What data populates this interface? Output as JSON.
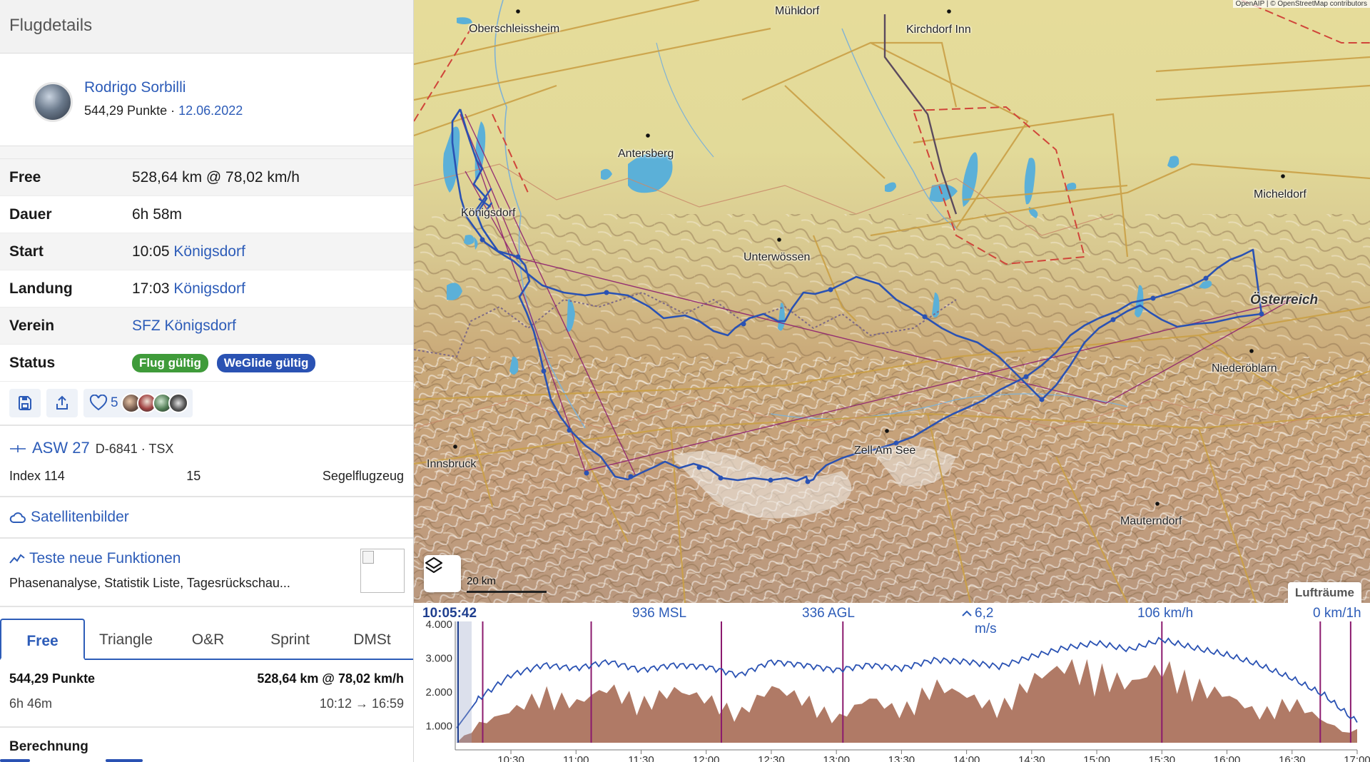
{
  "sidebar": {
    "title": "Flugdetails",
    "pilot": {
      "name": "Rodrigo Sorbilli",
      "points": "544,29 Punkte",
      "separator": "·",
      "date": "12.06.2022"
    },
    "details": [
      {
        "label": "Free",
        "value": "528,64 km @ 78,02 km/h"
      },
      {
        "label": "Dauer",
        "value": "6h 58m"
      },
      {
        "label": "Start",
        "time": "10:05",
        "place": "Königsdorf"
      },
      {
        "label": "Landung",
        "time": "17:03",
        "place": "Königsdorf"
      },
      {
        "label": "Verein",
        "club": "SFZ Königsdorf"
      },
      {
        "label": "Status",
        "badges": [
          "Flug gültig",
          "WeGlide gültig"
        ]
      }
    ],
    "likes": "5",
    "aircraft": {
      "type": "ASW 27",
      "registration": "D-6841 · TSX",
      "index": "Index 114",
      "number": "15",
      "category": "Segelflugzeug"
    },
    "satellite": "Satellitenbilder",
    "new_features": {
      "title": "Teste neue Funktionen",
      "desc": "Phasenanalyse, Statistik Liste, Tagesrückschau..."
    },
    "tabs": [
      "Free",
      "Triangle",
      "O&R",
      "Sprint",
      "DMSt"
    ],
    "score": {
      "points": "544,29 Punkte",
      "distance": "528,64 km @ 78,02 km/h",
      "duration": "6h 46m",
      "span": "10:12 → 16:59"
    },
    "calculation": "Berechnung"
  },
  "map": {
    "attribution": "OpenAIP | © OpenStreetMap contributors",
    "labels": [
      {
        "name": "Oberschleissheim"
      },
      {
        "name": "Mühldorf"
      },
      {
        "name": "Kirchdorf Inn"
      },
      {
        "name": "Antersberg"
      },
      {
        "name": "Königsdorf"
      },
      {
        "name": "Unterwössen"
      },
      {
        "name": "Micheldorf"
      },
      {
        "name": "Österreich"
      },
      {
        "name": "Niederöblarn"
      },
      {
        "name": "Innsbruck"
      },
      {
        "name": "Zell Am See"
      },
      {
        "name": "Mauterndorf"
      }
    ],
    "scale": "20 km",
    "airspaces": "Lufträume",
    "colors": {
      "track": "#2a52b3",
      "task": "#8b1a6e",
      "terrain": "#d8d09a"
    }
  },
  "barogram": {
    "time": "10:05:42",
    "msl": "936 MSL",
    "agl": "336 AGL",
    "vario": "6,2 m/s",
    "speed": "106 km/h",
    "wind": "0 km/1h",
    "y_ticks": [
      "4.000",
      "3.000",
      "2.000",
      "1.000"
    ],
    "x_ticks": [
      "10:30",
      "11:00",
      "11:30",
      "12:00",
      "12:30",
      "13:00",
      "13:30",
      "14:00",
      "14:30",
      "15:00",
      "15:30",
      "16:00",
      "16:30",
      "17:00"
    ]
  },
  "chart_data": {
    "type": "line",
    "x": [
      "10:05",
      "10:15",
      "10:30",
      "10:45",
      "11:00",
      "11:15",
      "11:30",
      "11:45",
      "12:00",
      "12:15",
      "12:30",
      "12:45",
      "13:00",
      "13:15",
      "13:30",
      "13:45",
      "14:00",
      "14:15",
      "14:30",
      "14:45",
      "15:00",
      "15:15",
      "15:30",
      "15:45",
      "16:00",
      "16:15",
      "16:30",
      "16:45",
      "17:00"
    ],
    "series": [
      {
        "values": [
          936,
          1800,
          2500,
          2800,
          2700,
          2900,
          2650,
          2800,
          2750,
          2500,
          2900,
          2800,
          2650,
          2800,
          2700,
          2950,
          2900,
          2750,
          3050,
          3300,
          3450,
          3250,
          3550,
          3300,
          3100,
          2800,
          2400,
          1900,
          1100
        ]
      },
      {
        "values": [
          0,
          700,
          1200,
          1900,
          1500,
          2100,
          1500,
          2000,
          1700,
          1100,
          2100,
          1700,
          900,
          1700,
          1200,
          2200,
          1800,
          1300,
          2400,
          2900,
          2700,
          2200,
          2900,
          2200,
          1800,
          1100,
          1600,
          800,
          200
        ]
      }
    ],
    "ylim": [
      500,
      4000
    ],
    "grid": false
  }
}
